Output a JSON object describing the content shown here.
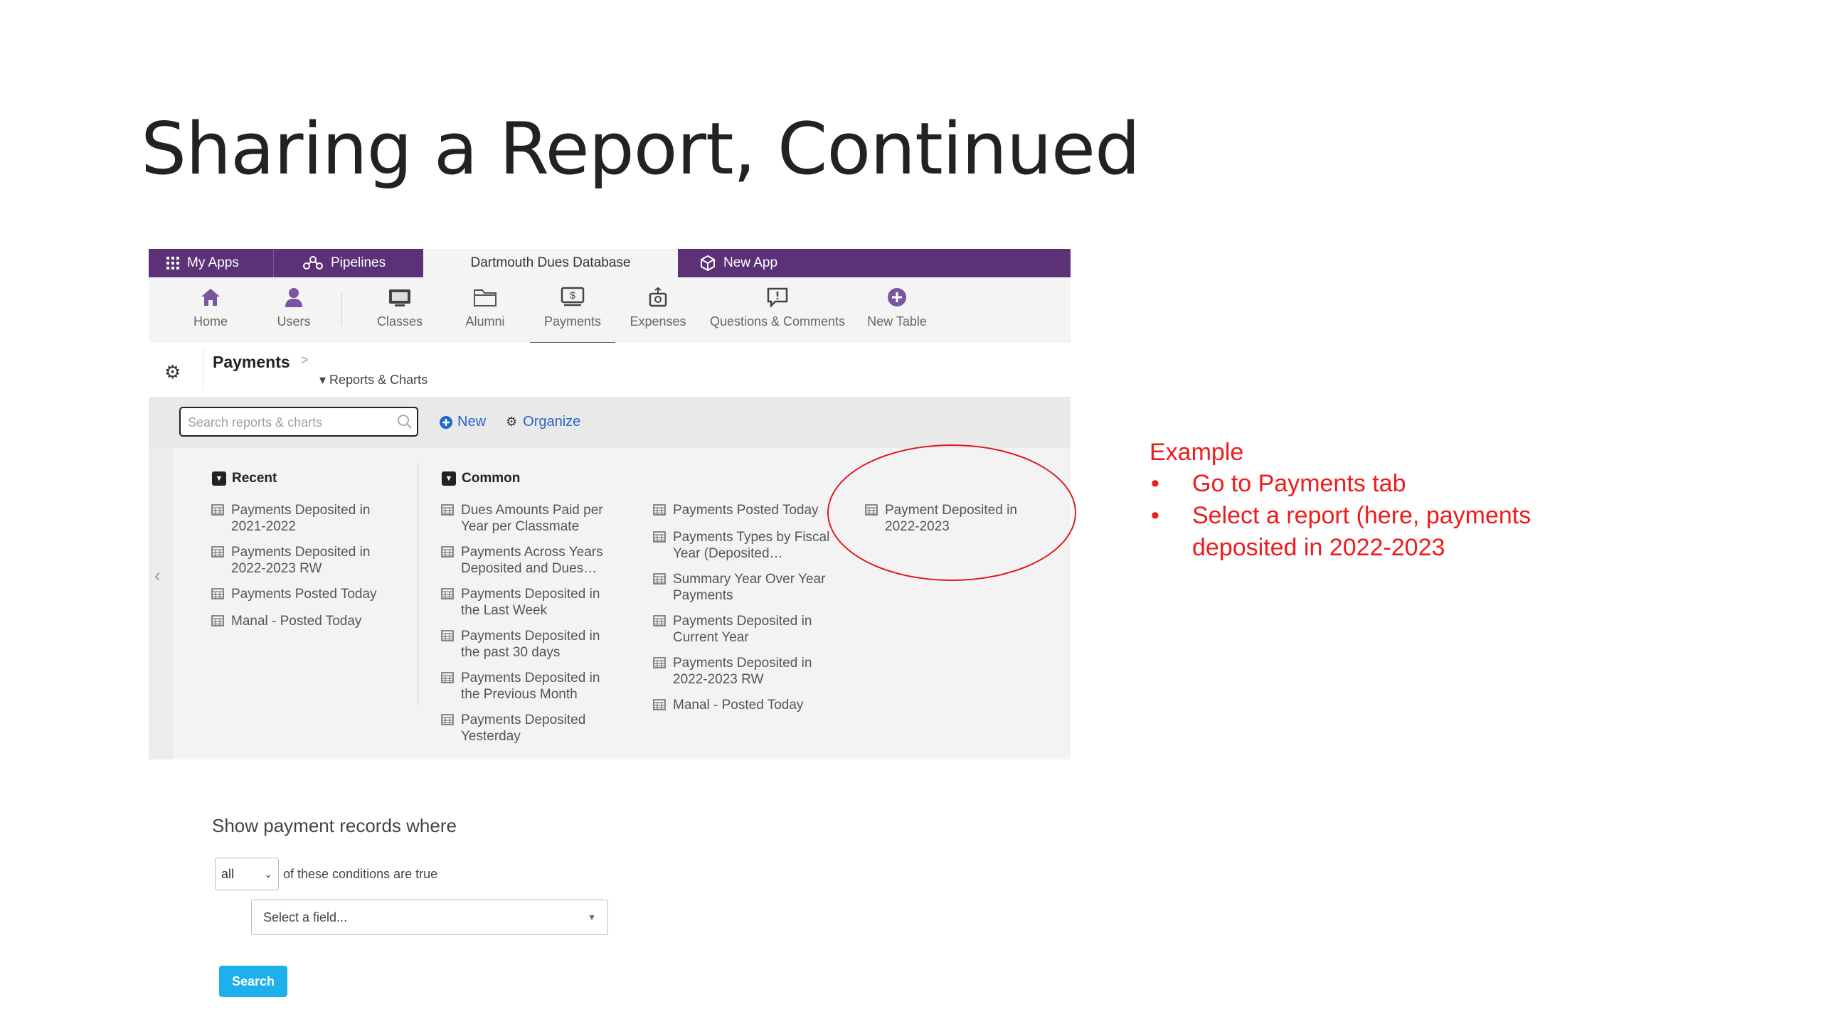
{
  "slide": {
    "title": "Sharing a Report, Continued"
  },
  "app": {
    "top_tabs": [
      {
        "label": "My Apps",
        "icon": "grid-icon"
      },
      {
        "label": "Pipelines",
        "icon": "pipelines-icon"
      },
      {
        "label": "Dartmouth Dues Database",
        "icon": ""
      },
      {
        "label": "New App",
        "icon": "cube-icon"
      }
    ],
    "nav": [
      {
        "label": "Home",
        "icon": "home-icon"
      },
      {
        "label": "Users",
        "icon": "user-icon"
      },
      {
        "label": "Classes",
        "icon": "classes-icon"
      },
      {
        "label": "Alumni",
        "icon": "folder-icon"
      },
      {
        "label": "Payments",
        "icon": "payments-icon"
      },
      {
        "label": "Expenses",
        "icon": "expenses-icon"
      },
      {
        "label": "Questions & Comments",
        "icon": "comment-icon"
      },
      {
        "label": "New Table",
        "icon": "plus-circle-icon"
      }
    ],
    "active_nav": "Payments",
    "breadcrumb": {
      "title": "Payments",
      "separator": ">",
      "sub": "▾ Reports & Charts"
    },
    "search": {
      "placeholder": "Search reports & charts"
    },
    "actions": {
      "new": "New",
      "organize": "Organize"
    },
    "sections": {
      "recent": {
        "title": "Recent",
        "items": [
          "Payments Deposited in\n2021-2022",
          "Payments Deposited in\n2022-2023 RW",
          "Payments Posted Today",
          "Manal - Posted Today"
        ]
      },
      "common": {
        "title": "Common",
        "col1": [
          "Dues Amounts Paid per\nYear per Classmate",
          "Payments Across Years\nDeposited and Dues…",
          "Payments Deposited in\nthe Last Week",
          "Payments Deposited in\nthe past 30 days",
          "Payments Deposited in\nthe Previous Month",
          "Payments Deposited\nYesterday"
        ],
        "col2": [
          "Payments Posted Today",
          "Payments Types by Fiscal\nYear (Deposited…",
          "Summary Year Over Year\nPayments",
          "Payments Deposited in\nCurrent Year",
          "Payments Deposited in\n2022-2023 RW",
          "Manal - Posted Today"
        ],
        "col3": [
          "Payment Deposited in\n2022-2023"
        ]
      }
    }
  },
  "annotation": {
    "title": "Example",
    "bullets": [
      "Go to Payments tab",
      "Select a report (here, payments deposited in 2022-2023"
    ],
    "color": "#ee1c1c"
  },
  "filter": {
    "heading": "Show payment records where",
    "match_value": "all",
    "conditions_text": "of these conditions are true",
    "field_placeholder": "Select a field...",
    "search_button": "Search"
  },
  "colors": {
    "tabbar": "#5c3177",
    "link": "#2466c9",
    "search_button": "#1eb0ec"
  }
}
